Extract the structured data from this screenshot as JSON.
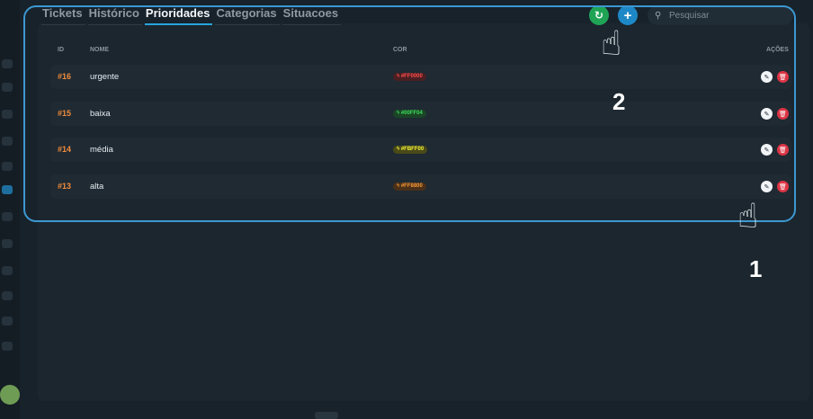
{
  "tabs": [
    {
      "label": "Tickets",
      "active": false
    },
    {
      "label": "Histórico",
      "active": false
    },
    {
      "label": "Prioridades",
      "active": true
    },
    {
      "label": "Categorias",
      "active": false
    },
    {
      "label": "Situacoes",
      "active": false
    }
  ],
  "toolbar": {
    "refresh_icon": "refresh-icon",
    "add_icon": "plus-icon",
    "add_glyph": "+",
    "refresh_glyph": "↻"
  },
  "search": {
    "placeholder": "Pesquisar",
    "value": "",
    "icon": "search-icon"
  },
  "table": {
    "headers": {
      "id": "ID",
      "name": "NOME",
      "color": "COR",
      "actions": "AÇÕES"
    },
    "rows": [
      {
        "id": "#16",
        "name": "urgente",
        "color": "#FF0000",
        "chip_bg": "#4a1f22",
        "chip_fg": "#ff4d4d"
      },
      {
        "id": "#15",
        "name": "baixa",
        "color": "#00FF04",
        "chip_bg": "#1b4526",
        "chip_fg": "#3ddc5a"
      },
      {
        "id": "#14",
        "name": "média",
        "color": "#FBFF00",
        "chip_bg": "#4a4a18",
        "chip_fg": "#f0f23a"
      },
      {
        "id": "#13",
        "name": "alta",
        "color": "#FF8800",
        "chip_bg": "#4a3018",
        "chip_fg": "#f59a3a"
      }
    ]
  },
  "annotations": [
    {
      "label": "1",
      "icon": "pointing-hand-icon"
    },
    {
      "label": "2",
      "icon": "pointing-hand-icon"
    }
  ],
  "colors": {
    "accent": "#27a4dc",
    "refresh": "#1fa455",
    "add": "#1e88c7",
    "delete": "#dc3545",
    "id_text": "#f28c3c"
  }
}
